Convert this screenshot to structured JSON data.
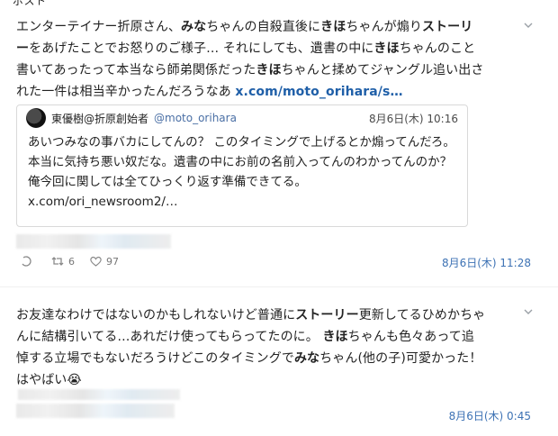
{
  "header_fragment": "ポスト",
  "posts": [
    {
      "segments": [
        {
          "t": "エンターテイナー折原さん、",
          "b": false
        },
        {
          "t": "みな",
          "b": true
        },
        {
          "t": "ちゃんの自殺直後に",
          "b": false
        },
        {
          "t": "きほ",
          "b": true
        },
        {
          "t": "ちゃんが煽り",
          "b": false
        },
        {
          "t": "ストーリー",
          "b": true
        },
        {
          "t": "をあげたことでお怒りのご様子… それにしても、遺書の中に",
          "b": false
        },
        {
          "t": "きほ",
          "b": true
        },
        {
          "t": "ちゃんのこと書いてあったって本当なら師弟関係だった",
          "b": false
        },
        {
          "t": "きほ",
          "b": true
        },
        {
          "t": "ちゃんと揉めてジャングル追い出された一件は相当辛かったんだろうなあ ",
          "b": false
        }
      ],
      "link_text": "x.com/moto_orihara/s…",
      "quote": {
        "name": "東優樹@折原創始者",
        "handle": "@moto_orihara",
        "time": "8月6日(木) 10:16",
        "body": "あいつみなの事バカにしてんの？ このタイミングで上げるとか煽ってんだろ。 本当に気持ち悪い奴だな。遺書の中にお前の名前入ってんのわかってんのか？ 俺今回に関しては全てひっくり返す準備できてる。",
        "link": "x.com/ori_newsroom2/…"
      },
      "reply_count": "",
      "retweet_count": "6",
      "like_count": "97",
      "timestamp": "8月6日(木) 11:28"
    },
    {
      "segments": [
        {
          "t": "お友達なわけではないのかもしれないけど普通に",
          "b": false
        },
        {
          "t": "ストーリー",
          "b": true
        },
        {
          "t": "更新してるひめかちゃんに結構引いてる…あれだけ使ってもらってたのに。 ",
          "b": false
        },
        {
          "t": "きほ",
          "b": true
        },
        {
          "t": "ちゃんも色々あって追悼する立場でもないだろうけどこのタイミングで",
          "b": false
        },
        {
          "t": "みな",
          "b": true
        },
        {
          "t": "ちゃん(他の子)可愛かった！はやばい",
          "b": false
        }
      ],
      "emoji": "😭",
      "timestamp": "8月6日(木) 0:45"
    }
  ]
}
